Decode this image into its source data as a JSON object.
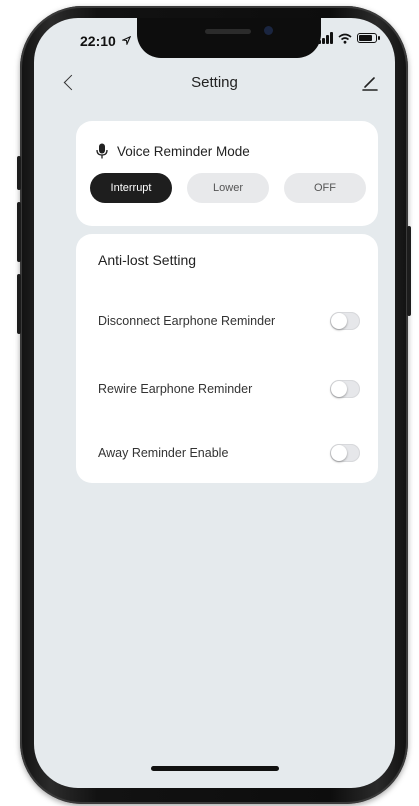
{
  "status_bar": {
    "time": "22:10"
  },
  "navbar": {
    "title": "Setting"
  },
  "voice_card": {
    "label": "Voice Reminder Mode",
    "options": [
      "Interrupt",
      "Lower",
      "OFF"
    ],
    "selected": "Interrupt"
  },
  "anti_lost": {
    "title": "Anti-lost Setting",
    "rows": [
      {
        "label": "Disconnect Earphone Reminder",
        "on": false
      },
      {
        "label": "Rewire Earphone Reminder",
        "on": false
      },
      {
        "label": "Away Reminder Enable",
        "on": false
      }
    ]
  },
  "colors": {
    "screen_bg": "#e5eaed",
    "card_bg": "#ffffff",
    "active_segment": "#1e1e1e"
  }
}
